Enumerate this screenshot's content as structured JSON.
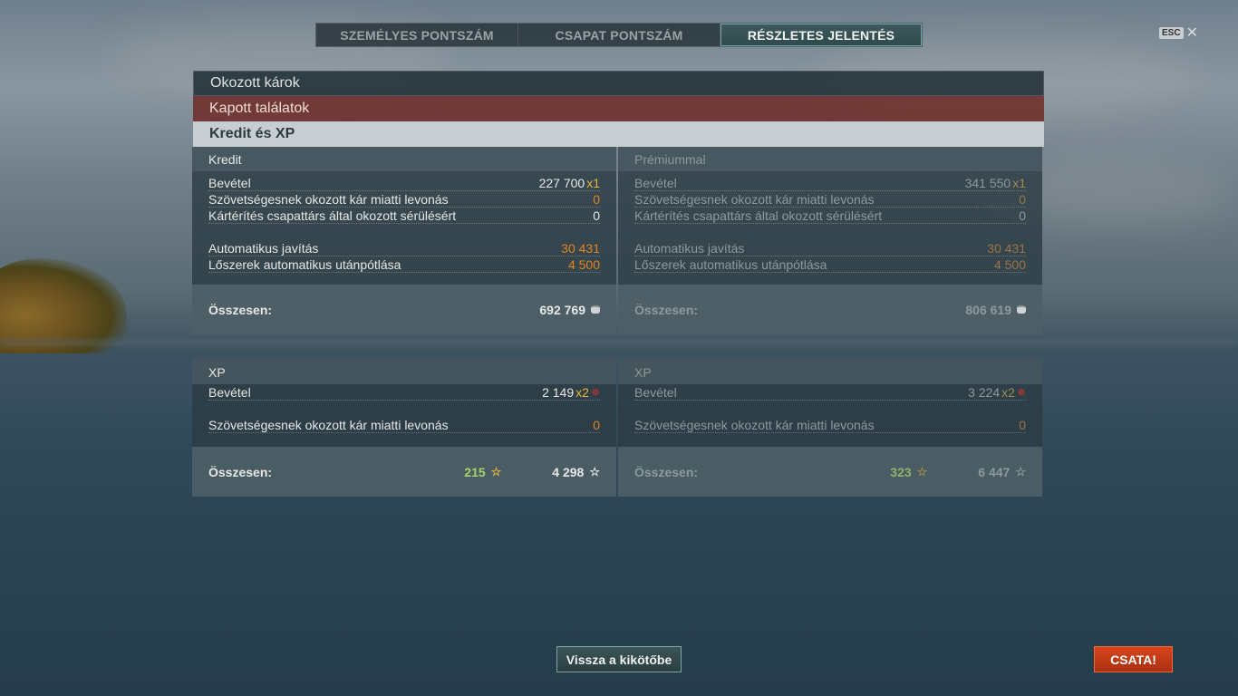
{
  "tabs": [
    {
      "label": "SZEMÉLYES PONTSZÁM"
    },
    {
      "label": "CSAPAT PONTSZÁM"
    },
    {
      "label": "RÉSZLETES JELENTÉS"
    }
  ],
  "esc_label": "ESC",
  "close_glyph": "✕",
  "sections": {
    "damage": "Okozott károk",
    "hits": "Kapott találatok",
    "credit_xp": "Kredit és XP"
  },
  "credit": {
    "standard": {
      "title": "Kredit",
      "rows": [
        {
          "label": "Bevétel",
          "value": "227 700",
          "mult": "x1"
        },
        {
          "label": "Szövetségesnek okozott kár miatti levonás",
          "value": "0"
        },
        {
          "label": "Kártérítés csapattárs által okozott sérülésért",
          "value": "0"
        },
        {
          "label": "Automatikus javítás",
          "value": "30 431"
        },
        {
          "label": "Lőszerek automatikus utánpótlása",
          "value": "4 500"
        }
      ],
      "total_label": "Összesen:",
      "total_value": "692 769"
    },
    "premium": {
      "title": "Prémiummal",
      "rows": [
        {
          "label": "Bevétel",
          "value": "341 550",
          "mult": "x1"
        },
        {
          "label": "Szövetségesnek okozott kár miatti levonás",
          "value": "0"
        },
        {
          "label": "Kártérítés csapattárs által okozott sérülésért",
          "value": "0"
        },
        {
          "label": "Automatikus javítás",
          "value": "30 431"
        },
        {
          "label": "Lőszerek automatikus utánpótlása",
          "value": "4 500"
        }
      ],
      "total_label": "Összesen:",
      "total_value": "806 619"
    }
  },
  "xp": {
    "standard": {
      "title": "XP",
      "rows": [
        {
          "label": "Bevétel",
          "value": "2 149",
          "mult": "x2"
        },
        {
          "label": "Szövetségesnek okozott kár miatti levonás",
          "value": "0"
        }
      ],
      "total_label": "Összesen:",
      "free_xp": "215",
      "total_value": "4 298"
    },
    "premium": {
      "title": "XP",
      "rows": [
        {
          "label": "Bevétel",
          "value": "3 224",
          "mult": "x2"
        },
        {
          "label": "Szövetségesnek okozott kár miatti levonás",
          "value": "0"
        }
      ],
      "total_label": "Összesen:",
      "free_xp": "323",
      "total_value": "6 447"
    }
  },
  "buttons": {
    "port": "Vissza a kikötőbe",
    "battle": "CSATA!"
  },
  "icons": {
    "credit": "coin-icon",
    "xp": "star-icon",
    "free_xp": "star-outline-icon",
    "flag": "wreath-icon"
  },
  "colors": {
    "orange": "#e3841c",
    "yellow": "#e8b63a",
    "green": "#a6d36a",
    "battle": "#c9391a",
    "hits_bar": "#6e2a26"
  }
}
